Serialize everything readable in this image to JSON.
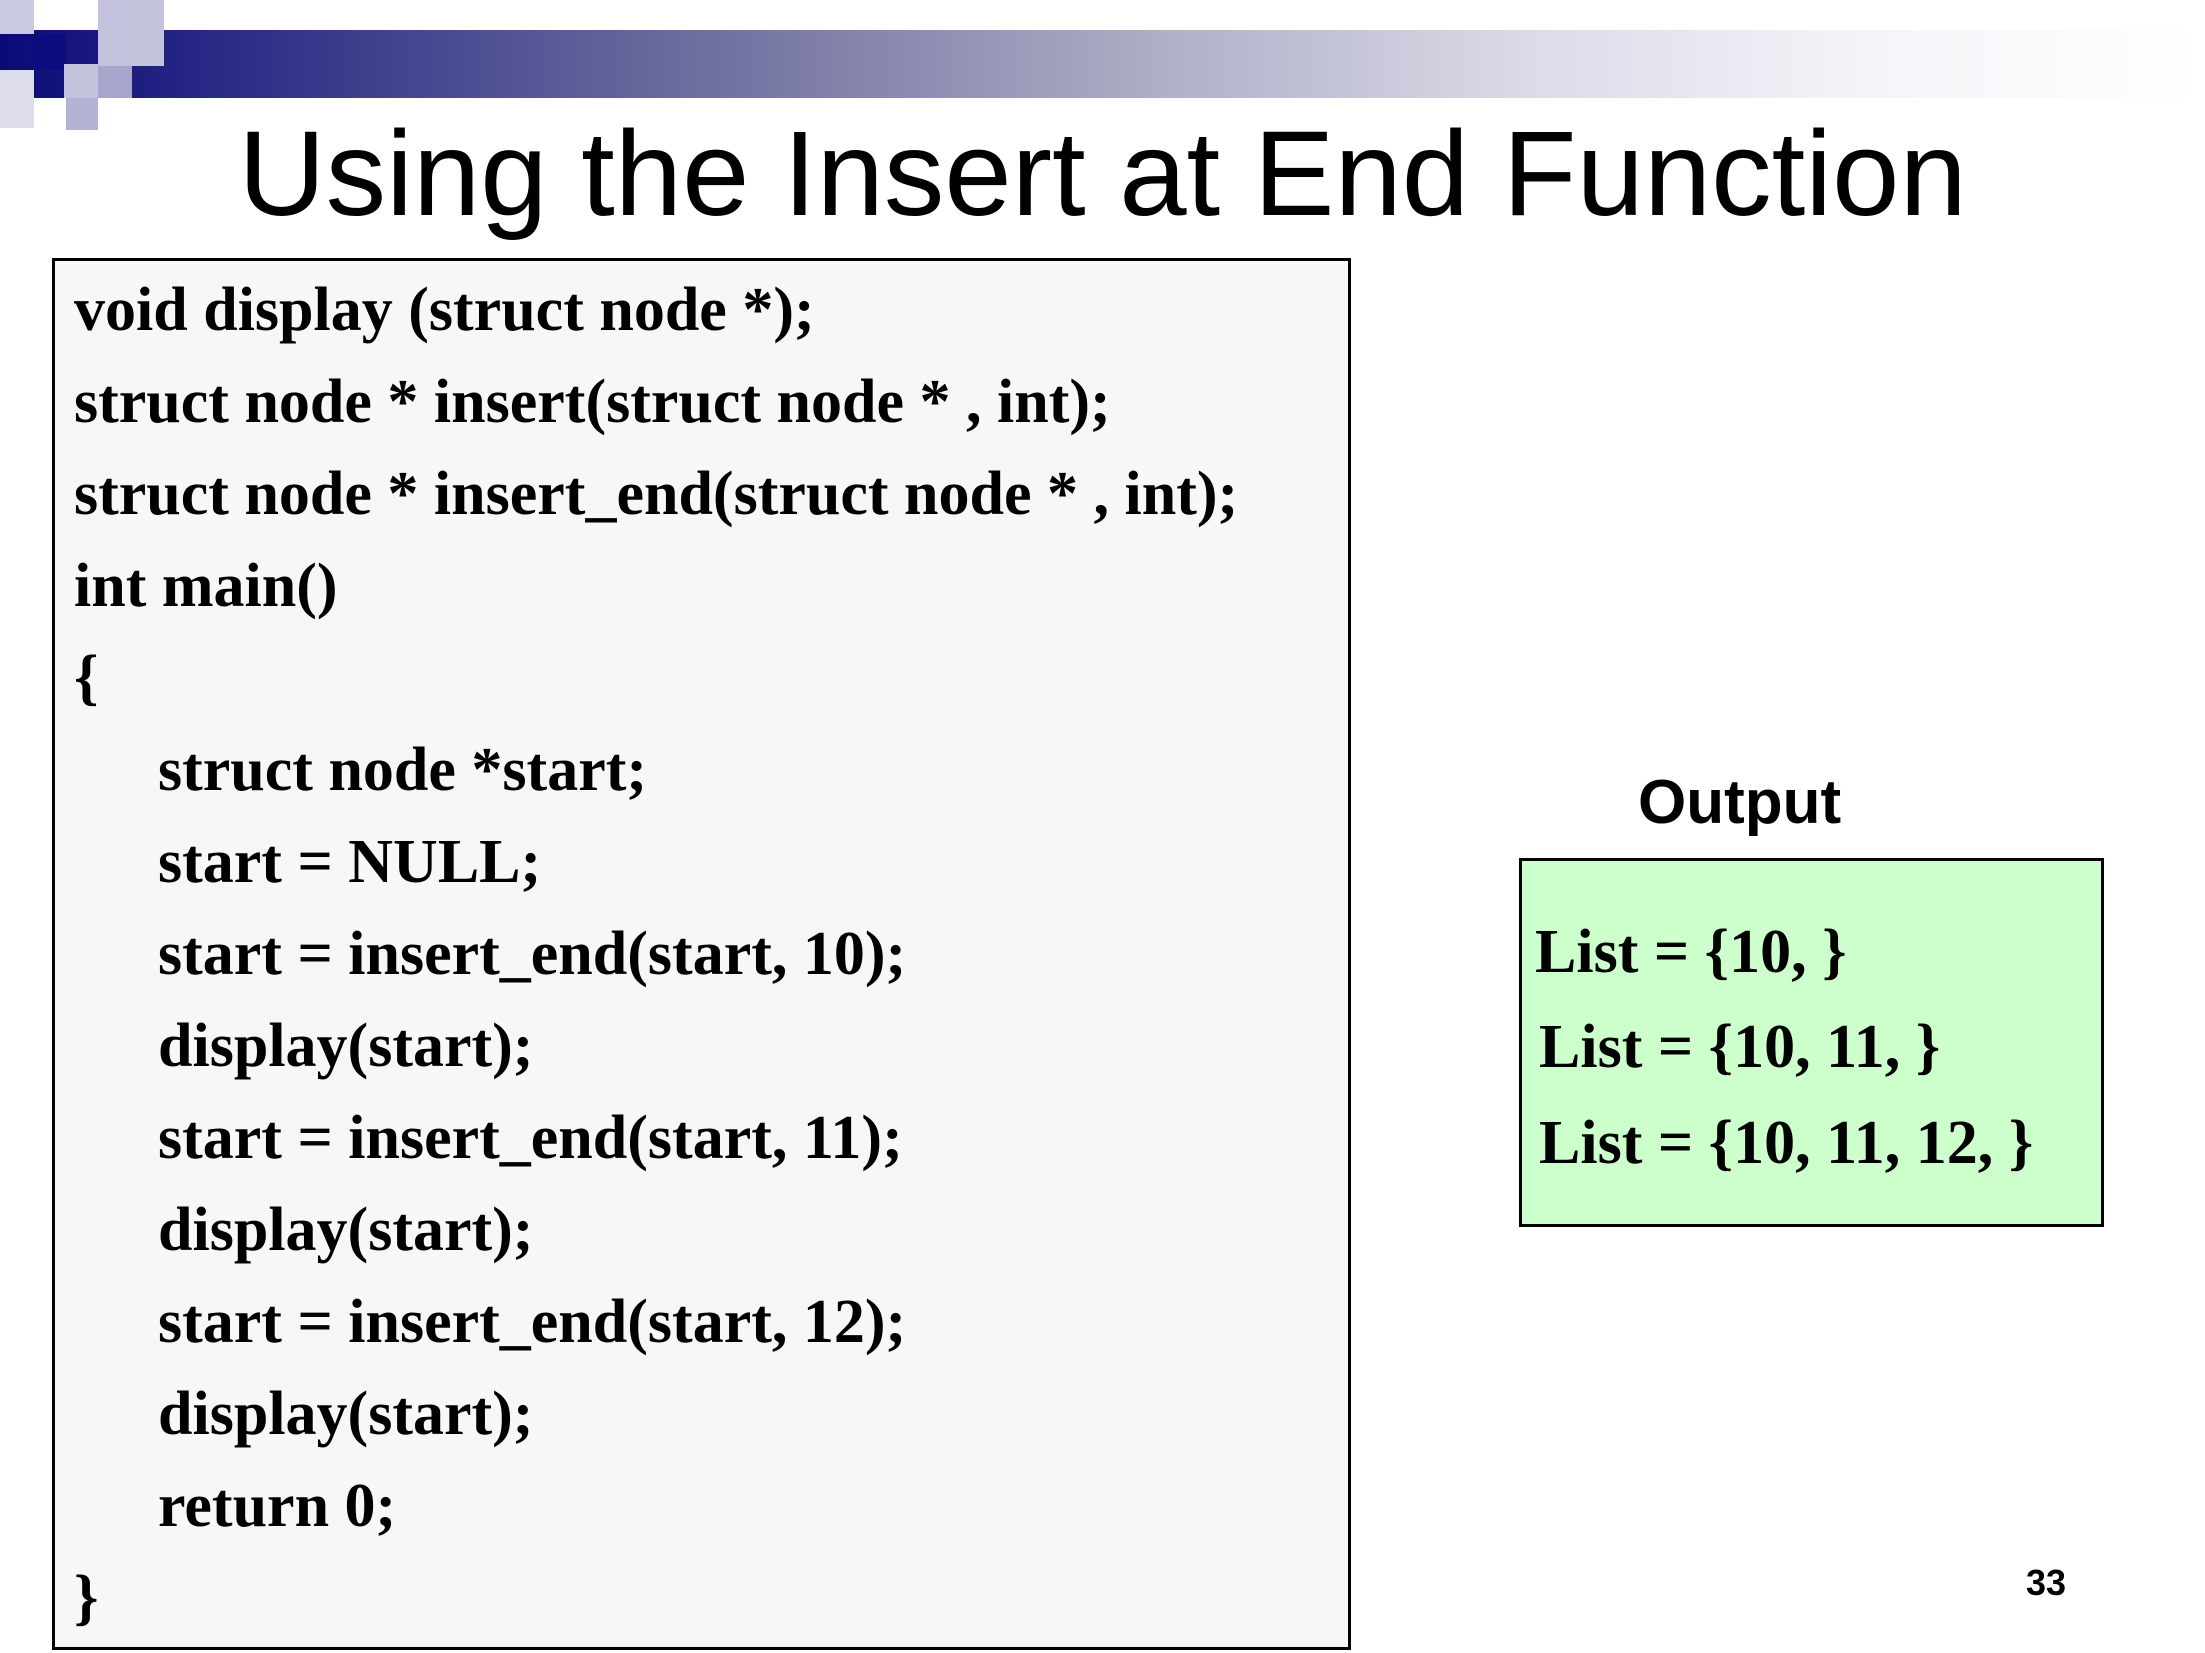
{
  "slide": {
    "title": "Using the Insert at End Function",
    "page_number": "33"
  },
  "code": {
    "lines": [
      "void display (struct node *);",
      "struct node * insert(struct node * , int);",
      "struct node * insert_end(struct node * , int);",
      "int main()",
      "{",
      "struct node *start;",
      "start = NULL;",
      "start = insert_end(start, 10);",
      "display(start);",
      "start = insert_end(start, 11);",
      "display(start);",
      "start = insert_end(start, 12);",
      "display(start);",
      "return 0;",
      "}"
    ]
  },
  "output": {
    "label": "Output",
    "lines": [
      "List = {10, }",
      "List = {10, 11, }",
      "List = {10, 11, 12, }"
    ]
  },
  "colors": {
    "header_dark": "#0a0a78",
    "code_box_background": "#f7f7f7",
    "output_box_background": "#ccffcc"
  }
}
